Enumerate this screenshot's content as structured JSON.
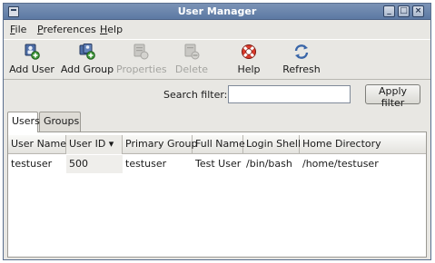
{
  "window": {
    "title": "User Manager",
    "controls": [
      "_",
      "□",
      "×"
    ]
  },
  "menubar": {
    "items": [
      {
        "label": "File",
        "mnemonic": "F",
        "rest": "ile"
      },
      {
        "label": "Preferences",
        "mnemonic": "P",
        "rest": "references"
      },
      {
        "label": "Help",
        "mnemonic": "H",
        "rest": "elp"
      }
    ]
  },
  "toolbar": {
    "add_user": "Add User",
    "add_group": "Add Group",
    "properties": "Properties",
    "delete": "Delete",
    "help": "Help",
    "refresh": "Refresh"
  },
  "search": {
    "label": "Search filter:",
    "value": "",
    "apply_label": "Apply filter"
  },
  "tabs": [
    {
      "label": "Users",
      "active": true
    },
    {
      "label": "Groups",
      "active": false
    }
  ],
  "table": {
    "columns": [
      "User Name",
      "User ID",
      "Primary Group",
      "Full Name",
      "Login Shell",
      "Home Directory"
    ],
    "sort_indicator": "▾",
    "rows": [
      [
        "testuser",
        "500",
        "testuser",
        "Test User",
        "/bin/bash",
        "/home/testuser"
      ]
    ]
  }
}
